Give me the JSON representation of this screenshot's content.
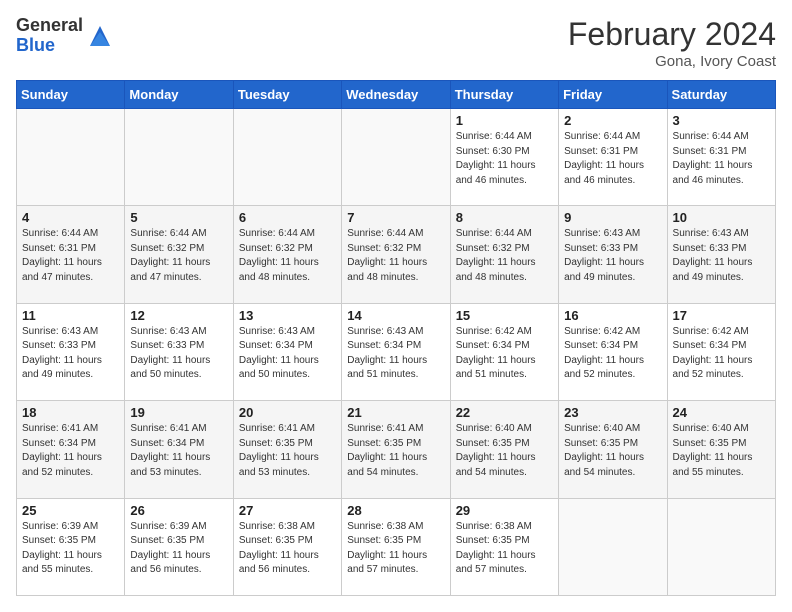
{
  "logo": {
    "general": "General",
    "blue": "Blue"
  },
  "title": {
    "month_year": "February 2024",
    "location": "Gona, Ivory Coast"
  },
  "headers": [
    "Sunday",
    "Monday",
    "Tuesday",
    "Wednesday",
    "Thursday",
    "Friday",
    "Saturday"
  ],
  "weeks": [
    [
      {
        "day": "",
        "info": ""
      },
      {
        "day": "",
        "info": ""
      },
      {
        "day": "",
        "info": ""
      },
      {
        "day": "",
        "info": ""
      },
      {
        "day": "1",
        "info": "Sunrise: 6:44 AM\nSunset: 6:30 PM\nDaylight: 11 hours and 46 minutes."
      },
      {
        "day": "2",
        "info": "Sunrise: 6:44 AM\nSunset: 6:31 PM\nDaylight: 11 hours and 46 minutes."
      },
      {
        "day": "3",
        "info": "Sunrise: 6:44 AM\nSunset: 6:31 PM\nDaylight: 11 hours and 46 minutes."
      }
    ],
    [
      {
        "day": "4",
        "info": "Sunrise: 6:44 AM\nSunset: 6:31 PM\nDaylight: 11 hours and 47 minutes."
      },
      {
        "day": "5",
        "info": "Sunrise: 6:44 AM\nSunset: 6:32 PM\nDaylight: 11 hours and 47 minutes."
      },
      {
        "day": "6",
        "info": "Sunrise: 6:44 AM\nSunset: 6:32 PM\nDaylight: 11 hours and 48 minutes."
      },
      {
        "day": "7",
        "info": "Sunrise: 6:44 AM\nSunset: 6:32 PM\nDaylight: 11 hours and 48 minutes."
      },
      {
        "day": "8",
        "info": "Sunrise: 6:44 AM\nSunset: 6:32 PM\nDaylight: 11 hours and 48 minutes."
      },
      {
        "day": "9",
        "info": "Sunrise: 6:43 AM\nSunset: 6:33 PM\nDaylight: 11 hours and 49 minutes."
      },
      {
        "day": "10",
        "info": "Sunrise: 6:43 AM\nSunset: 6:33 PM\nDaylight: 11 hours and 49 minutes."
      }
    ],
    [
      {
        "day": "11",
        "info": "Sunrise: 6:43 AM\nSunset: 6:33 PM\nDaylight: 11 hours and 49 minutes."
      },
      {
        "day": "12",
        "info": "Sunrise: 6:43 AM\nSunset: 6:33 PM\nDaylight: 11 hours and 50 minutes."
      },
      {
        "day": "13",
        "info": "Sunrise: 6:43 AM\nSunset: 6:34 PM\nDaylight: 11 hours and 50 minutes."
      },
      {
        "day": "14",
        "info": "Sunrise: 6:43 AM\nSunset: 6:34 PM\nDaylight: 11 hours and 51 minutes."
      },
      {
        "day": "15",
        "info": "Sunrise: 6:42 AM\nSunset: 6:34 PM\nDaylight: 11 hours and 51 minutes."
      },
      {
        "day": "16",
        "info": "Sunrise: 6:42 AM\nSunset: 6:34 PM\nDaylight: 11 hours and 52 minutes."
      },
      {
        "day": "17",
        "info": "Sunrise: 6:42 AM\nSunset: 6:34 PM\nDaylight: 11 hours and 52 minutes."
      }
    ],
    [
      {
        "day": "18",
        "info": "Sunrise: 6:41 AM\nSunset: 6:34 PM\nDaylight: 11 hours and 52 minutes."
      },
      {
        "day": "19",
        "info": "Sunrise: 6:41 AM\nSunset: 6:34 PM\nDaylight: 11 hours and 53 minutes."
      },
      {
        "day": "20",
        "info": "Sunrise: 6:41 AM\nSunset: 6:35 PM\nDaylight: 11 hours and 53 minutes."
      },
      {
        "day": "21",
        "info": "Sunrise: 6:41 AM\nSunset: 6:35 PM\nDaylight: 11 hours and 54 minutes."
      },
      {
        "day": "22",
        "info": "Sunrise: 6:40 AM\nSunset: 6:35 PM\nDaylight: 11 hours and 54 minutes."
      },
      {
        "day": "23",
        "info": "Sunrise: 6:40 AM\nSunset: 6:35 PM\nDaylight: 11 hours and 54 minutes."
      },
      {
        "day": "24",
        "info": "Sunrise: 6:40 AM\nSunset: 6:35 PM\nDaylight: 11 hours and 55 minutes."
      }
    ],
    [
      {
        "day": "25",
        "info": "Sunrise: 6:39 AM\nSunset: 6:35 PM\nDaylight: 11 hours and 55 minutes."
      },
      {
        "day": "26",
        "info": "Sunrise: 6:39 AM\nSunset: 6:35 PM\nDaylight: 11 hours and 56 minutes."
      },
      {
        "day": "27",
        "info": "Sunrise: 6:38 AM\nSunset: 6:35 PM\nDaylight: 11 hours and 56 minutes."
      },
      {
        "day": "28",
        "info": "Sunrise: 6:38 AM\nSunset: 6:35 PM\nDaylight: 11 hours and 57 minutes."
      },
      {
        "day": "29",
        "info": "Sunrise: 6:38 AM\nSunset: 6:35 PM\nDaylight: 11 hours and 57 minutes."
      },
      {
        "day": "",
        "info": ""
      },
      {
        "day": "",
        "info": ""
      }
    ]
  ],
  "row_shades": [
    "white",
    "shade",
    "white",
    "shade",
    "white"
  ]
}
